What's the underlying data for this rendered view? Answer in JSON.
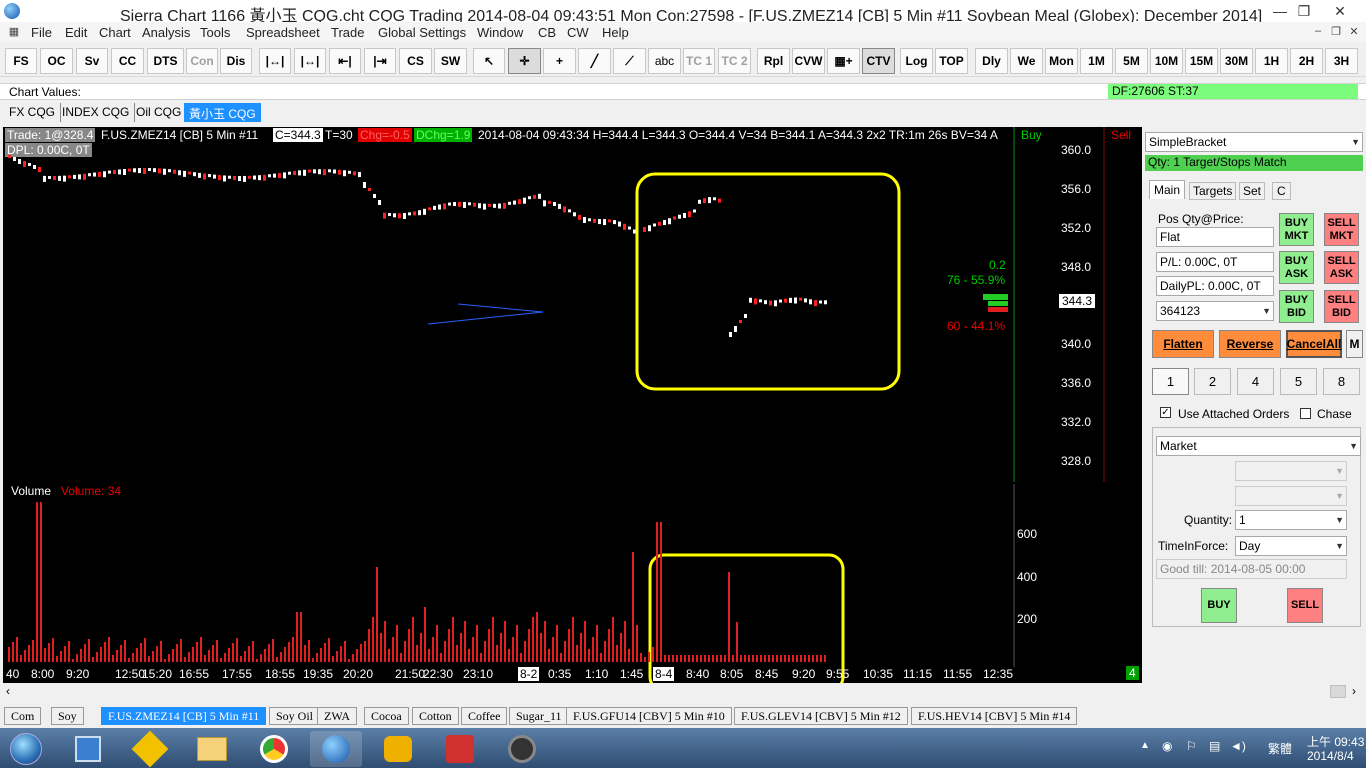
{
  "window": {
    "title": "Sierra Chart 1166 黃小玉 CQG.cht  CQG Trading 2014-08-04  09:43:51 Mon  Con:27598 - [F.US.ZMEZ14 [CB]  5 Min  #11  Soybean Meal (Globex): December 2014]",
    "minimize": "—",
    "restore": "❐",
    "close": "✕"
  },
  "menu": [
    "File",
    "Edit",
    "Chart",
    "Analysis",
    "Tools",
    "Spreadsheet",
    "Trade",
    "Global Settings",
    "Window",
    "CB",
    "CW",
    "Help"
  ],
  "toolbar": {
    "left": [
      "FS",
      "OC",
      "Sv",
      "CC",
      "DTS",
      "Con",
      "Dis"
    ],
    "tools_text": [
      "CS",
      "SW"
    ],
    "abc": "abc",
    "tc1": "TC 1",
    "tc2": "TC 2",
    "mid": [
      "Rpl",
      "CVW"
    ],
    "ctv": "CTV",
    "right": [
      "Log",
      "TOP",
      "Dly",
      "We",
      "Mon",
      "1M",
      "5M",
      "10M",
      "15M",
      "30M",
      "1H",
      "2H",
      "3H"
    ]
  },
  "chart_values": {
    "label": "Chart Values:",
    "df": "DF:27606  ST:37"
  },
  "chartbook_tabs": [
    "FX CQG",
    "INDEX CQG",
    "Oil CQG",
    "黃小玉 CQG"
  ],
  "chart_header": {
    "trade": "Trade: 1@328.4",
    "symbol": "F.US.ZMEZ14 [CB]  5 Min  #11",
    "c": "C=344.3",
    "t": "T=30",
    "chg": "Chg=-0.5",
    "dchg": "DChg=1.9",
    "rest": "2014-08-04 09:43:34 H=344.4 L=344.3 O=344.4 V=34 B=344.1 A=344.3 2x2 TR:1m 26s BV=34 A",
    "dpl": "DPL: 0.00C, 0T",
    "buy": "Buy",
    "sell": "Sell"
  },
  "price_axis": {
    "labels": [
      "360.0",
      "356.0",
      "352.0",
      "348.0",
      "344.0",
      "340.0",
      "336.0",
      "332.0",
      "328.0"
    ],
    "current": "344.3"
  },
  "dom": {
    "top_value": "0.2",
    "buy_stat": "76 - 55.9%",
    "sell_stat": "60 - 44.1%"
  },
  "volume": {
    "title": "Volume",
    "value_label": "Volume: 34",
    "axis": [
      "600",
      "400",
      "200"
    ]
  },
  "time_axis": [
    "40",
    "8:00",
    "9:20",
    "12:50",
    "15:20",
    "16:55",
    "17:55",
    "18:55",
    "19:35",
    "20:20",
    "21:50",
    "22:30",
    "23:10",
    "8-2",
    "0:35",
    "1:10",
    "1:45",
    "8-4",
    "8:40",
    "8:05",
    "8:45",
    "9:20",
    "9:55",
    "10:35",
    "11:15",
    "11:55",
    "12:35"
  ],
  "corner_badge": "4",
  "trade_panel": {
    "bracket": "SimpleBracket",
    "qty_status": "Qty: 1 Target/Stops Match",
    "tabs": [
      "Main",
      "Targets",
      "Set",
      "C"
    ],
    "pos_label": "Pos Qty@Price:",
    "pos_value": "Flat",
    "pl_value": "P/L: 0.00C, 0T",
    "daily_pl": "DailyPL: 0.00C, 0T",
    "account": "364123",
    "buy_mkt": "BUY MKT",
    "sell_mkt": "SELL MKT",
    "buy_ask": "BUY ASK",
    "sell_ask": "SELL ASK",
    "buy_bid": "BUY BID",
    "sell_bid": "SELL BID",
    "flatten": "Flatten",
    "reverse": "Reverse",
    "cancel_all": "CancelAll",
    "m": "M",
    "qty_buttons": [
      "1",
      "2",
      "4",
      "5",
      "8"
    ],
    "use_attached": "Use Attached Orders",
    "chase": "Chase",
    "order_type": "Market",
    "quantity_label": "Quantity:",
    "quantity_value": "1",
    "tif_label": "TimeInForce:",
    "tif_value": "Day",
    "good_till": "Good till: 2014-08-05 00:00",
    "buy": "BUY",
    "sell": "SELL",
    "colors": {
      "buy_green": "#90ee90",
      "sell_red": "#ff8080",
      "orange": "#ff8c3a"
    }
  },
  "bottom_tabs": [
    "Com",
    "Soy",
    "F.US.ZMEZ14 [CB]  5 Min  #11",
    "Soy Oil",
    "ZWA",
    "Cocoa",
    "Cotton",
    "Coffee",
    "Sugar_11",
    "F.US.GFU14 [CBV]  5 Min  #10",
    "F.US.GLEV14 [CBV]  5 Min  #12",
    "F.US.HEV14 [CBV]  5 Min  #14"
  ],
  "tray": {
    "ime": "繁體",
    "time": "上午 09:43",
    "date": "2014/8/4"
  }
}
